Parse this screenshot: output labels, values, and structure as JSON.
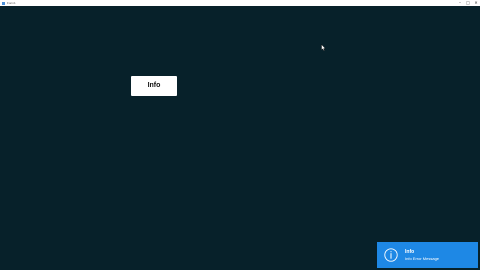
{
  "window": {
    "title": "Form1",
    "minimize_label": "–",
    "maximize_label": "□",
    "close_label": "✕"
  },
  "main": {
    "info_button_label": "Info"
  },
  "toast": {
    "icon": "info-icon",
    "title": "Info",
    "message": "Info Error Message"
  },
  "colors": {
    "background": "#07212a",
    "toast": "#1e88e5",
    "button": "#ffffff"
  }
}
